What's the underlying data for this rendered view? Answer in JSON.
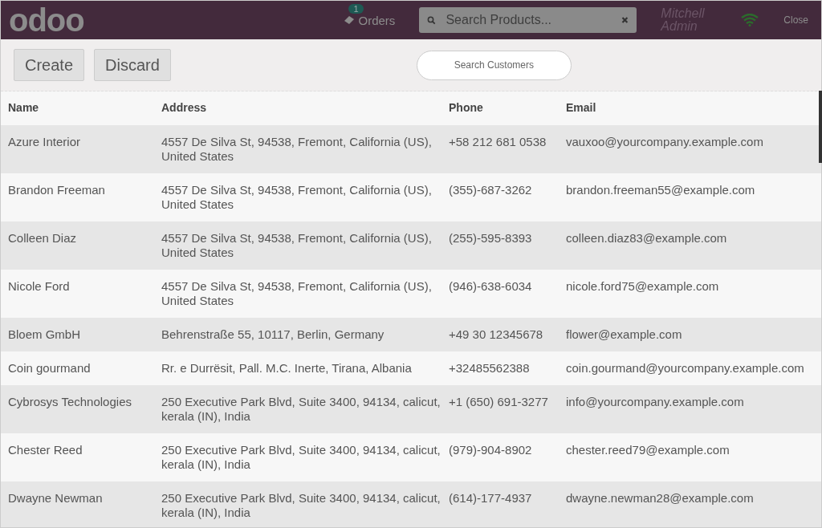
{
  "header": {
    "logo": "odoo",
    "orders": {
      "label": "Orders",
      "count": "1"
    },
    "product_search": {
      "placeholder": "Search Products..."
    },
    "user": "Mitchell Admin",
    "close": "Close"
  },
  "toolbar": {
    "buttons": [
      "Create",
      "Discard"
    ],
    "customer_search": {
      "placeholder": "Search Customers"
    }
  },
  "table": {
    "columns": [
      "Name",
      "Address",
      "Phone",
      "Email"
    ],
    "rows": [
      {
        "cells": [
          "Azure Interior",
          "4557 De Silva St, 94538, Fremont, California (US), United States",
          "+58 212 681 0538",
          "vauxoo@yourcompany.example.com"
        ]
      },
      {
        "cells": [
          "Brandon Freeman",
          "4557 De Silva St, 94538, Fremont, California (US), United States",
          "(355)-687-3262",
          "brandon.freeman55@example.com"
        ]
      },
      {
        "cells": [
          "Colleen Diaz",
          "4557 De Silva St, 94538, Fremont, California (US), United States",
          "(255)-595-8393",
          "colleen.diaz83@example.com"
        ]
      },
      {
        "cells": [
          "Nicole Ford",
          "4557 De Silva St, 94538, Fremont, California (US), United States",
          "(946)-638-6034",
          "nicole.ford75@example.com"
        ]
      },
      {
        "cells": [
          "Bloem GmbH",
          "Behrenstraße 55, 10117, Berlin, Germany",
          "+49 30 12345678",
          "flower@example.com"
        ]
      },
      {
        "cells": [
          "Coin gourmand",
          "Rr. e Durrësit, Pall. M.C. Inerte, Tirana, Albania",
          "+32485562388",
          "coin.gourmand@yourcompany.example.com"
        ]
      },
      {
        "cells": [
          "Cybrosys Technologies",
          "250 Executive Park Blvd, Suite 3400, 94134, calicut, kerala (IN), India",
          "+1 (650) 691-3277",
          "info@yourcompany.example.com"
        ]
      },
      {
        "cells": [
          "Chester Reed",
          "250 Executive Park Blvd, Suite 3400, 94134, calicut, kerala (IN), India",
          "(979)-904-8902",
          "chester.reed79@example.com"
        ]
      },
      {
        "cells": [
          "Dwayne Newman",
          "250 Executive Park Blvd, Suite 3400, 94134, calicut, kerala (IN), India",
          "(614)-177-4937",
          "dwayne.newman28@example.com"
        ]
      }
    ]
  }
}
